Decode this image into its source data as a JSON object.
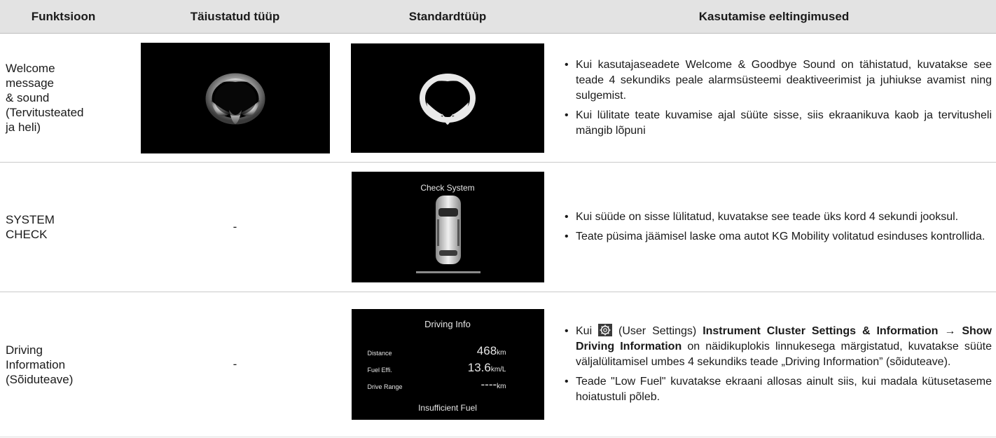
{
  "table": {
    "headers": [
      "Funktsioon",
      "Täiustatud tüüp",
      "Standardtüüp",
      "Kasutamise eeltingimused"
    ],
    "rows": [
      {
        "function": "Welcome\nmessage\n& sound\n(Tervitusteated\nja heli)",
        "advanced": "",
        "standard": "",
        "conditions": [
          "Kui kasutajaseadete Welcome & Goodbye Sound on tähistatud, kuvatakse see teade 4 sekundiks peale alarmsüsteemi deaktiveerimist ja juhiukse avamist ning sulgemist.",
          "Kui lülitate teate kuvamise ajal süüte sisse, siis ekraanikuva kaob ja tervitusheli mängib lõpuni"
        ]
      },
      {
        "function": "SYSTEM\nCHECK",
        "advanced": "-",
        "standard_screen": {
          "title": "Check System"
        },
        "conditions": [
          "Kui süüde on sisse lülitatud, kuvatakse see teade üks kord 4 sekundi jooksul.",
          "Teate püsima jäämisel laske oma autot KG Mobility volitatud esinduses kontrollida."
        ]
      },
      {
        "function": "Driving\nInformation\n(Sõiduteave)",
        "advanced": "-",
        "standard_screen": {
          "title": "Driving Info",
          "rows": [
            {
              "label": "Distance",
              "value": "468",
              "unit": "km"
            },
            {
              "label": "Fuel Effi.",
              "value": "13.6",
              "unit": "km/L"
            },
            {
              "label": "Drive Range",
              "value": "----",
              "unit": "km"
            }
          ],
          "footer": "Insufficient Fuel"
        },
        "conditions": [
          {
            "prefix": "Kui ",
            "icon": "gear-settings-icon",
            "middle": " (User Settings) ",
            "bold1": "Instrument Cluster Settings & Information →  Show Driving Information",
            "rest": " on näidikuplokis linnukesega märgistatud, kuvatakse süüte väljalülitamisel umbes 4 sekundiks teade „Driving Information” (sõiduteave)."
          },
          "Teade \"Low Fuel\" kuvatakse ekraani allosas ainult siis, kui madala kütusetaseme hoiatustuli põleb."
        ]
      }
    ]
  }
}
